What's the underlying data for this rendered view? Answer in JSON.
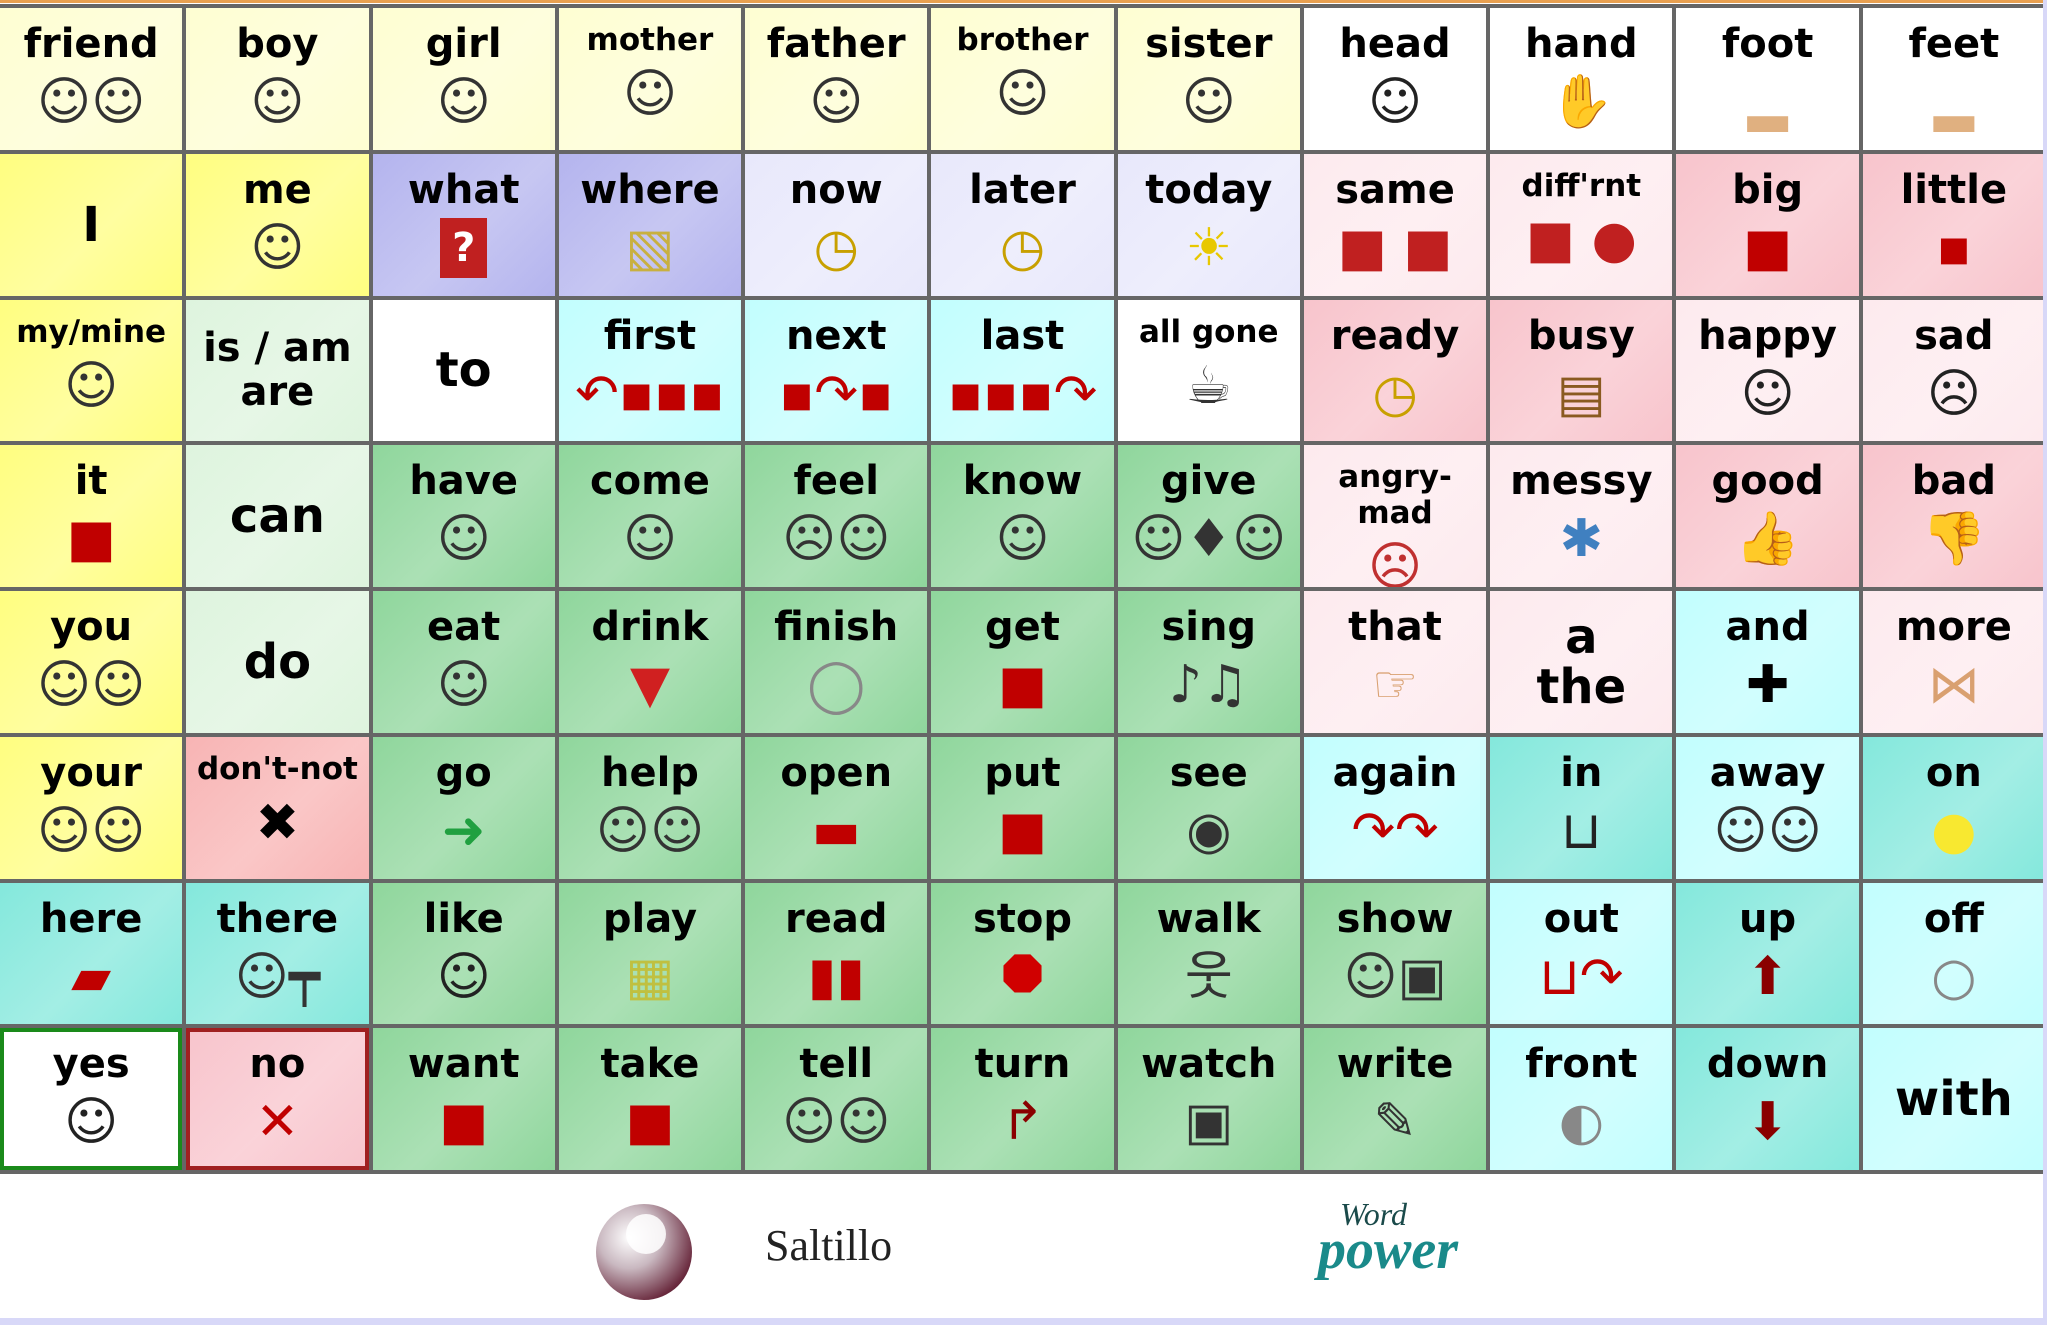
{
  "palette": {
    "paleyellow": "#fefed2",
    "yellow": "#fffe80",
    "lavender": "#b4b4ee",
    "palelavender": "#e8e8fb",
    "white": "#ffffff",
    "lightpink": "#fdeaee",
    "pink": "#f8c4cc",
    "palegreen": "#def4de",
    "green": "#8fd69c",
    "cyan": "#c2fefe",
    "teal": "#84e8dc",
    "salmon": "#f8b4b4"
  },
  "cells": [
    {
      "label": "friend",
      "icon": "people",
      "color": "paleyellow"
    },
    {
      "label": "boy",
      "icon": "person",
      "color": "paleyellow"
    },
    {
      "label": "girl",
      "icon": "person",
      "color": "paleyellow"
    },
    {
      "label": "mother",
      "icon": "person",
      "color": "paleyellow",
      "size": "small"
    },
    {
      "label": "father",
      "icon": "person",
      "color": "paleyellow"
    },
    {
      "label": "brother",
      "icon": "person",
      "color": "paleyellow",
      "size": "small"
    },
    {
      "label": "sister",
      "icon": "person",
      "color": "paleyellow"
    },
    {
      "label": "head",
      "icon": "face",
      "color": "white"
    },
    {
      "label": "hand",
      "icon": "hand",
      "color": "white"
    },
    {
      "label": "foot",
      "icon": "foot",
      "color": "white"
    },
    {
      "label": "feet",
      "icon": "foot",
      "color": "white"
    },
    {
      "label": "I",
      "icon": "",
      "color": "yellow",
      "size": "big",
      "center": true
    },
    {
      "label": "me",
      "icon": "person",
      "color": "yellow"
    },
    {
      "label": "what",
      "icon": "question",
      "color": "lavender"
    },
    {
      "label": "where",
      "icon": "map",
      "color": "lavender"
    },
    {
      "label": "now",
      "icon": "clock",
      "color": "palelavender"
    },
    {
      "label": "later",
      "icon": "clock",
      "color": "palelavender"
    },
    {
      "label": "today",
      "icon": "sun",
      "color": "palelavender"
    },
    {
      "label": "same",
      "icon": "squares",
      "color": "lightpink"
    },
    {
      "label": "diff'rnt",
      "icon": "square-circle",
      "color": "lightpink",
      "size": "small"
    },
    {
      "label": "big",
      "icon": "big-square",
      "color": "pink"
    },
    {
      "label": "little",
      "icon": "small-square",
      "color": "pink"
    },
    {
      "label": "my/mine",
      "icon": "person",
      "color": "yellow",
      "size": "small"
    },
    {
      "label": "is / am\nare",
      "icon": "",
      "color": "palegreen",
      "center": true
    },
    {
      "label": "to",
      "icon": "",
      "color": "white",
      "size": "big",
      "center": true
    },
    {
      "label": "first",
      "icon": "arrow-left",
      "color": "cyan"
    },
    {
      "label": "next",
      "icon": "arrow-curve",
      "color": "cyan"
    },
    {
      "label": "last",
      "icon": "arrow-right",
      "color": "cyan"
    },
    {
      "label": "all gone",
      "icon": "cup",
      "color": "white",
      "size": "small"
    },
    {
      "label": "ready",
      "icon": "clock",
      "color": "pink"
    },
    {
      "label": "busy",
      "icon": "desk",
      "color": "pink"
    },
    {
      "label": "happy",
      "icon": "smile",
      "color": "lightpink"
    },
    {
      "label": "sad",
      "icon": "frown",
      "color": "lightpink"
    },
    {
      "label": "it",
      "icon": "cube",
      "color": "yellow"
    },
    {
      "label": "can",
      "icon": "",
      "color": "palegreen",
      "size": "big",
      "center": true
    },
    {
      "label": "have",
      "icon": "person",
      "color": "green"
    },
    {
      "label": "come",
      "icon": "person",
      "color": "green"
    },
    {
      "label": "feel",
      "icon": "faces",
      "color": "green"
    },
    {
      "label": "know",
      "icon": "person",
      "color": "green"
    },
    {
      "label": "give",
      "icon": "gift",
      "color": "green"
    },
    {
      "label": "angry-mad",
      "icon": "angry",
      "color": "lightpink",
      "size": "small"
    },
    {
      "label": "messy",
      "icon": "mess",
      "color": "lightpink"
    },
    {
      "label": "good",
      "icon": "thumbs-up",
      "color": "pink"
    },
    {
      "label": "bad",
      "icon": "thumbs-down",
      "color": "pink"
    },
    {
      "label": "you",
      "icon": "people",
      "color": "yellow"
    },
    {
      "label": "do",
      "icon": "",
      "color": "palegreen",
      "size": "big",
      "center": true
    },
    {
      "label": "eat",
      "icon": "person",
      "color": "green"
    },
    {
      "label": "drink",
      "icon": "drink",
      "color": "green"
    },
    {
      "label": "finish",
      "icon": "plate",
      "color": "green"
    },
    {
      "label": "get",
      "icon": "cube",
      "color": "green"
    },
    {
      "label": "sing",
      "icon": "music",
      "color": "green"
    },
    {
      "label": "that",
      "icon": "point",
      "color": "lightpink"
    },
    {
      "label": "a\nthe",
      "icon": "",
      "color": "lightpink",
      "size": "big",
      "center": true
    },
    {
      "label": "and",
      "icon": "plus",
      "color": "cyan"
    },
    {
      "label": "more",
      "icon": "hands",
      "color": "lightpink"
    },
    {
      "label": "your",
      "icon": "people",
      "color": "yellow"
    },
    {
      "label": "don't-not",
      "icon": "x-bold",
      "color": "salmon",
      "size": "small"
    },
    {
      "label": "go",
      "icon": "arrow-go",
      "color": "green"
    },
    {
      "label": "help",
      "icon": "people",
      "color": "green"
    },
    {
      "label": "open",
      "icon": "box-open",
      "color": "green"
    },
    {
      "label": "put",
      "icon": "cube",
      "color": "green"
    },
    {
      "label": "see",
      "icon": "eye",
      "color": "green"
    },
    {
      "label": "again",
      "icon": "arrows-again",
      "color": "cyan"
    },
    {
      "label": "in",
      "icon": "in-box",
      "color": "teal"
    },
    {
      "label": "away",
      "icon": "people",
      "color": "cyan"
    },
    {
      "label": "on",
      "icon": "bulb-on",
      "color": "teal"
    },
    {
      "label": "here",
      "icon": "point-down",
      "color": "teal"
    },
    {
      "label": "there",
      "icon": "signpost",
      "color": "teal"
    },
    {
      "label": "like",
      "icon": "smile",
      "color": "green"
    },
    {
      "label": "play",
      "icon": "blocks",
      "color": "green"
    },
    {
      "label": "read",
      "icon": "book",
      "color": "green"
    },
    {
      "label": "stop",
      "icon": "stop-sign",
      "color": "green"
    },
    {
      "label": "walk",
      "icon": "walker",
      "color": "green"
    },
    {
      "label": "show",
      "icon": "picture",
      "color": "green"
    },
    {
      "label": "out",
      "icon": "out-box",
      "color": "cyan"
    },
    {
      "label": "up",
      "icon": "arrow-up",
      "color": "teal"
    },
    {
      "label": "off",
      "icon": "bulb-off",
      "color": "cyan"
    },
    {
      "label": "yes",
      "icon": "smile",
      "color": "white",
      "border": "#1a8a1a"
    },
    {
      "label": "no",
      "icon": "x-thin",
      "color": "pink",
      "border": "#a02020"
    },
    {
      "label": "want",
      "icon": "cube",
      "color": "green"
    },
    {
      "label": "take",
      "icon": "cube",
      "color": "green"
    },
    {
      "label": "tell",
      "icon": "people",
      "color": "green"
    },
    {
      "label": "turn",
      "icon": "arrow-turn",
      "color": "green"
    },
    {
      "label": "watch",
      "icon": "tv",
      "color": "green"
    },
    {
      "label": "write",
      "icon": "pencil",
      "color": "green"
    },
    {
      "label": "front",
      "icon": "disc",
      "color": "cyan"
    },
    {
      "label": "down",
      "icon": "arrow-down",
      "color": "teal"
    },
    {
      "label": "with",
      "icon": "",
      "color": "cyan",
      "size": "big",
      "center": true
    }
  ],
  "footer": {
    "saltillo": "Saltillo",
    "wordpower_word": "Word",
    "wordpower_power": "power"
  }
}
